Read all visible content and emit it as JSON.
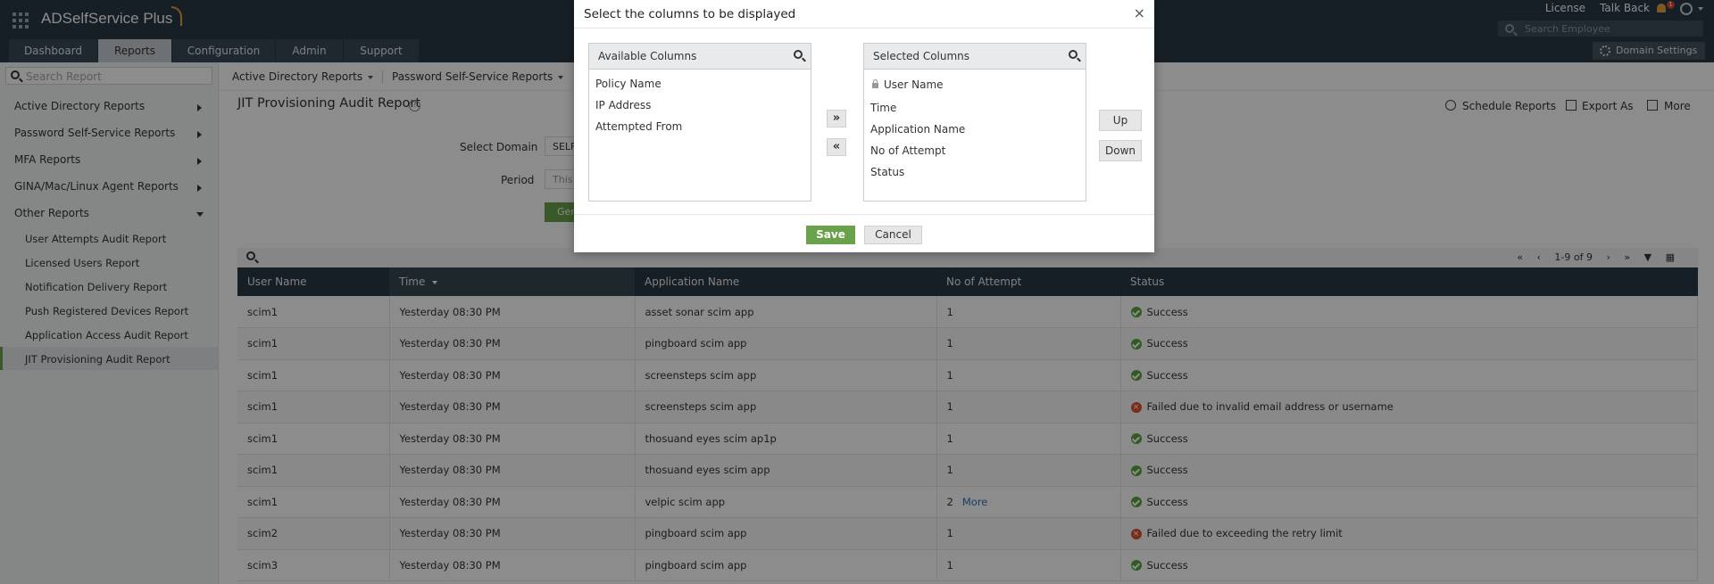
{
  "header": {
    "app_name": "ADSelfService Plus",
    "links": [
      "License",
      "Talk Back"
    ],
    "notification_count": "1",
    "employee_search_placeholder": "Search Employee",
    "domain_settings": "Domain Settings"
  },
  "nav": {
    "tabs": [
      "Dashboard",
      "Reports",
      "Configuration",
      "Admin",
      "Support"
    ],
    "active_tab": "Reports"
  },
  "sidebar": {
    "search_placeholder": "Search Report",
    "groups": [
      "Active Directory Reports",
      "Password Self-Service Reports",
      "MFA Reports",
      "GINA/Mac/Linux Agent Reports",
      "Other Reports"
    ],
    "sub_items": [
      "User Attempts Audit Report",
      "Licensed Users Report",
      "Notification Delivery Report",
      "Push Registered Devices Report",
      "Application Access Audit Report",
      "JIT Provisioning Audit Report"
    ],
    "active_item": "JIT Provisioning Audit Report"
  },
  "submenu": {
    "items": [
      "Active Directory Reports",
      "Password Self-Service Reports"
    ]
  },
  "report": {
    "title": "JIT Provisioning Audit Report",
    "help": "?",
    "actions": [
      "Schedule Reports",
      "Export As",
      "More"
    ],
    "form": {
      "domain_label": "Select Domain",
      "domain_value": "SELF",
      "period_label": "Period",
      "period_value": "This",
      "generate_label": "Gen"
    }
  },
  "table": {
    "pager": {
      "range": "1-9 of 9"
    },
    "columns": [
      "User Name",
      "Time",
      "Application Name",
      "No of Attempt",
      "Status"
    ],
    "sorted_column": "Time",
    "rows": [
      {
        "user": "scim1",
        "time": "Yesterday 08:30 PM",
        "app": "asset sonar scim app",
        "attempts": "1",
        "more": "",
        "status": "Success",
        "ok": true
      },
      {
        "user": "scim1",
        "time": "Yesterday 08:30 PM",
        "app": "pingboard scim app",
        "attempts": "1",
        "more": "",
        "status": "Success",
        "ok": true
      },
      {
        "user": "scim1",
        "time": "Yesterday 08:30 PM",
        "app": "screensteps scim app",
        "attempts": "1",
        "more": "",
        "status": "Success",
        "ok": true
      },
      {
        "user": "scim1",
        "time": "Yesterday 08:30 PM",
        "app": "screensteps scim app",
        "attempts": "1",
        "more": "",
        "status": "Failed due to invalid email address or username",
        "ok": false
      },
      {
        "user": "scim1",
        "time": "Yesterday 08:30 PM",
        "app": "thosuand eyes scim ap1p",
        "attempts": "1",
        "more": "",
        "status": "Success",
        "ok": true
      },
      {
        "user": "scim1",
        "time": "Yesterday 08:30 PM",
        "app": "thosuand eyes scim app",
        "attempts": "1",
        "more": "",
        "status": "Success",
        "ok": true
      },
      {
        "user": "scim1",
        "time": "Yesterday 08:30 PM",
        "app": "velpic scim app",
        "attempts": "2",
        "more": "More",
        "status": "Success",
        "ok": true
      },
      {
        "user": "scim2",
        "time": "Yesterday 08:30 PM",
        "app": "pingboard scim app",
        "attempts": "1",
        "more": "",
        "status": "Failed due to exceeding the retry limit",
        "ok": false
      },
      {
        "user": "scim3",
        "time": "Yesterday 08:30 PM",
        "app": "pingboard scim app",
        "attempts": "1",
        "more": "",
        "status": "Success",
        "ok": true
      }
    ]
  },
  "modal": {
    "title": "Select the columns to be displayed",
    "close": "×",
    "available_header": "Available Columns",
    "available": [
      "Policy Name",
      "IP Address",
      "Attempted From"
    ],
    "selected_header": "Selected Columns",
    "selected_locked": "User Name",
    "selected": [
      "Time",
      "Application Name",
      "No of Attempt",
      "Status"
    ],
    "move_right": "»",
    "move_left": "«",
    "up": "Up",
    "down": "Down",
    "save": "Save",
    "cancel": "Cancel"
  },
  "colors": {
    "header_bg": "#2b3a45",
    "accent_green": "#6aa24c",
    "fail_red": "#d9532b",
    "link_blue": "#2f73b6"
  }
}
